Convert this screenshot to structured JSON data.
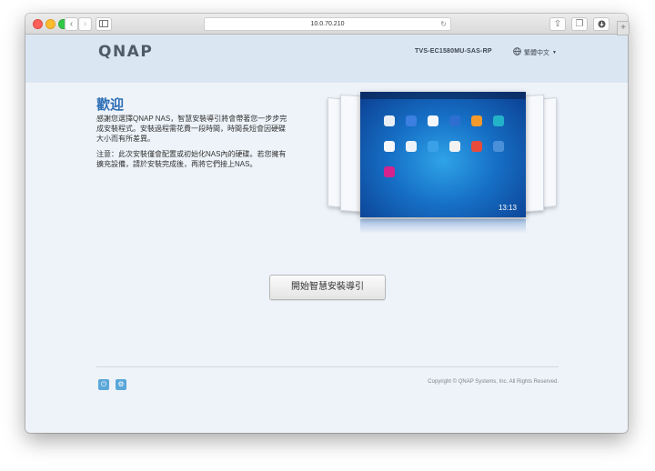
{
  "browser": {
    "url": "10.0.70.210"
  },
  "header": {
    "logo": "QNAP",
    "model": "TVS-EC1580MU-SAS-RP",
    "language": "繁體中文"
  },
  "welcome": {
    "title": "歡迎",
    "paragraph1_line1": "感謝您選擇QNAP NAS，智慧安裝導引將會帶著您一步步完",
    "paragraph1_line2": "成安裝程式。安裝過程需花費一段時間，時間長短會因硬碟",
    "paragraph1_line3": "大小而有所差異。",
    "paragraph2_line1": "注意：此次安裝僅會配置或初始化NAS內的硬碟。若您擁有",
    "paragraph2_line2": "擴充設備，請於安裝完成後，再將它們接上NAS。"
  },
  "desktop_preview": {
    "clock": "13:13"
  },
  "start_button": {
    "label": "開始智慧安裝導引"
  },
  "footer": {
    "copyright": "Copyright © QNAP Systems, Inc. All Rights Reserved."
  },
  "colors": {
    "accent": "#2f6fb5",
    "header_bg": "#dbe6f3",
    "page_bg": "#eef3f9",
    "footer_icon": "#5aa7d8"
  },
  "icons": [
    "back-icon",
    "forward-icon",
    "sidebar-icon",
    "reload-icon",
    "share-icon",
    "tabs-icon",
    "download-icon",
    "globe-icon",
    "chevron-down-icon",
    "power-icon",
    "gear-icon"
  ]
}
